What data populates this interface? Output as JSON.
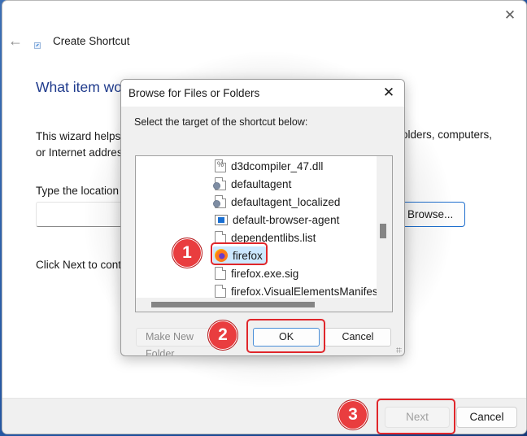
{
  "wizard": {
    "title": "Create Shortcut",
    "heading": "What item wo",
    "description_line1": "This wizard helps y",
    "description_line2": "or Internet addres",
    "description_right": "olders, computers,",
    "location_label": "Type the location o",
    "location_value": "",
    "browse_label": "Browse...",
    "next_instruction": "Click Next to conti",
    "next_label": "Next",
    "cancel_label": "Cancel",
    "icons": {
      "back": "back-arrow-icon",
      "close": "close-icon",
      "app": "shortcut-icon"
    }
  },
  "browse_dialog": {
    "title": "Browse for Files or Folders",
    "prompt": "Select the target of the shortcut below:",
    "items": [
      {
        "name": "d3dcompiler_47.dll",
        "icon": "dll-file-icon"
      },
      {
        "name": "defaultagent",
        "icon": "config-file-icon"
      },
      {
        "name": "defaultagent_localized",
        "icon": "config-file-icon"
      },
      {
        "name": "default-browser-agent",
        "icon": "application-icon"
      },
      {
        "name": "dependentlibs.list",
        "icon": "file-icon"
      },
      {
        "name": "firefox",
        "icon": "firefox-icon",
        "selected": true
      },
      {
        "name": "firefox.exe.sig",
        "icon": "file-icon"
      },
      {
        "name": "firefox.VisualElementsManifest",
        "icon": "file-icon"
      }
    ],
    "make_new_folder_label": "Make New Folder",
    "ok_label": "OK",
    "cancel_label": "Cancel"
  },
  "annotations": [
    {
      "number": "1",
      "target": "firefox"
    },
    {
      "number": "2",
      "target": "OK"
    },
    {
      "number": "3",
      "target": "Next"
    }
  ],
  "colors": {
    "annotation_red": "#e93d3f",
    "heading_blue": "#1e3a8c",
    "selection": "#cce8ff",
    "focus_blue": "#1f6fce"
  }
}
